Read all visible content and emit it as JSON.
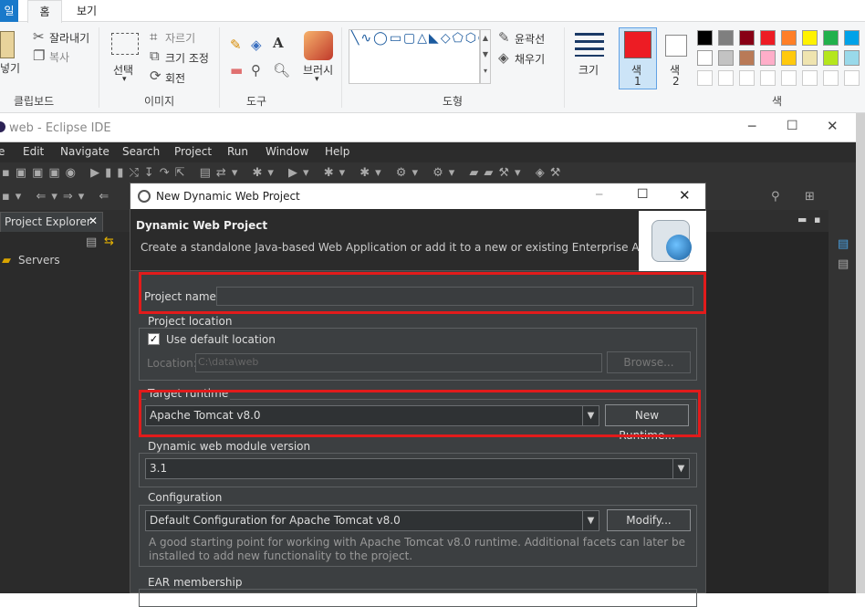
{
  "paint": {
    "tabs": {
      "file": "일",
      "home": "홈",
      "view": "보기"
    },
    "clipboard": {
      "paste": "넣기",
      "cut": "잘라내기",
      "copy": "복사",
      "group": "클립보드"
    },
    "image": {
      "select": "선택",
      "crop": "자르기",
      "resize": "크기 조정",
      "rotate": "회전",
      "group": "이미지"
    },
    "tools": {
      "group": "도구"
    },
    "brush": {
      "label": "브러시"
    },
    "shapes": {
      "outline": "윤곽선",
      "fill": "채우기",
      "group": "도형"
    },
    "size": {
      "label": "크기"
    },
    "color1": {
      "label": "색",
      "num": "1",
      "value": "#ed1c24"
    },
    "color2": {
      "label": "색",
      "num": "2",
      "value": "#ffffff"
    },
    "colors": {
      "group": "색"
    },
    "palette_row1": [
      "#000000",
      "#7f7f7f",
      "#880015",
      "#ed1c24",
      "#ff7f27",
      "#fff200",
      "#22b14c",
      "#00a2e8"
    ],
    "palette_row2": [
      "#ffffff",
      "#c3c3c3",
      "#b97a57",
      "#ffaec9",
      "#ffc90e",
      "#efe4b0",
      "#b5e61d",
      "#99d9ea"
    ]
  },
  "eclipse": {
    "title": "web - Eclipse IDE",
    "menu": [
      "e",
      "Edit",
      "Navigate",
      "Search",
      "Project",
      "Run",
      "Window",
      "Help"
    ],
    "explorer": {
      "tab": "Project Explorer",
      "item": "Servers"
    }
  },
  "dialog": {
    "title": "New Dynamic Web Project",
    "header": "Dynamic Web Project",
    "description": "Create a standalone Java-based Web Application or add it to a new or existing Enterprise Application.",
    "project_name_label": "Project name:",
    "project_name_value": "",
    "location_group": "Project location",
    "use_default": "Use default location",
    "location_label": "Location:",
    "location_value": "C:\\data\\web",
    "browse": "Browse...",
    "runtime_group": "Target runtime",
    "runtime_value": "Apache Tomcat v8.0",
    "new_runtime": "New Runtime...",
    "module_group": "Dynamic web module version",
    "module_value": "3.1",
    "config_group": "Configuration",
    "config_value": "Default Configuration for Apache Tomcat v8.0",
    "modify": "Modify...",
    "config_desc": "A good starting point for working with Apache Tomcat v8.0 runtime. Additional facets can later be installed to add new functionality to the project.",
    "ear_group": "EAR membership"
  }
}
